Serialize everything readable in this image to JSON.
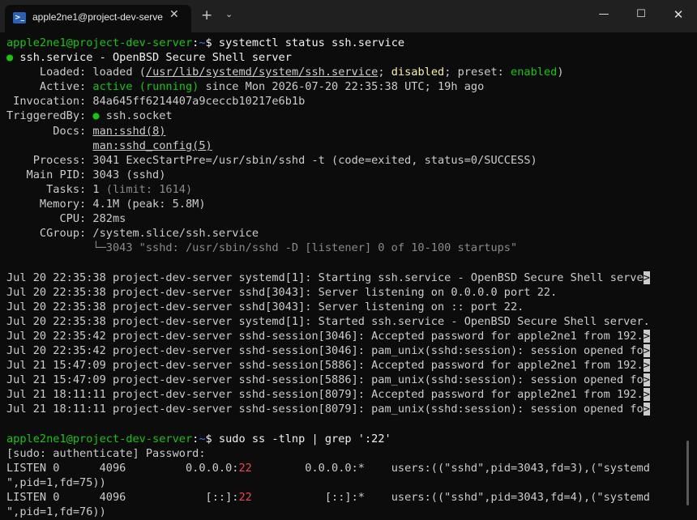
{
  "window": {
    "tab_title": "apple2ne1@project-dev-serve",
    "tab_icon": ">_",
    "close_glyph": "✕",
    "newtab_glyph": "+",
    "dropdown_glyph": "⌄",
    "min_glyph": "—",
    "max_glyph": "☐",
    "winclose_glyph": "✕"
  },
  "colors": {
    "background": "#0c0c0c",
    "prompt_user": "#16c60c",
    "prompt_path": "#3b78ff",
    "text": "#cccccc"
  },
  "prompt": {
    "user_host": "apple2ne1@project-dev-server",
    "sep": ":",
    "path": "~",
    "dollar": "$ "
  },
  "cmd1": "systemctl status ssh.service",
  "status": {
    "bullet": "●",
    "header": " ssh.service - OpenBSD Secure Shell server",
    "loaded_label": "     Loaded: ",
    "loaded_pre": "loaded (",
    "loaded_path": "/usr/lib/systemd/system/ssh.service",
    "loaded_sep1": "; ",
    "loaded_disabled": "disabled",
    "loaded_mid": "; preset: ",
    "loaded_enabled": "enabled",
    "loaded_end": ")",
    "active_label": "     Active: ",
    "active_state": "active (running)",
    "active_rest": " since Mon 2026-07-20 22:35:38 UTC; 19h ago",
    "invocation": " Invocation: 84a645ff6214407a9ceccb10217e6b1b",
    "triggered_label": "TriggeredBy: ",
    "triggered_rest": " ssh.socket",
    "docs_label": "       Docs: ",
    "docs1": "man:sshd(8)",
    "docs_indent": "             ",
    "docs2": "man:sshd_config(5)",
    "process": "    Process: 3041 ExecStartPre=/usr/sbin/sshd -t (code=exited, status=0/SUCCESS)",
    "mainpid": "   Main PID: 3043 (sshd)",
    "tasks_pre": "      Tasks: 1",
    "tasks_limit": " (limit: 1614)",
    "memory": "     Memory: 4.1M (peak: 5.8M)",
    "cpu": "        CPU: 282ms",
    "cgroup": "     CGroup: /system.slice/ssh.service",
    "cgroup_child": "             └─3043 \"sshd: /usr/sbin/sshd -D [listener] 0 of 10-100 startups\""
  },
  "logs": [
    {
      "text": "Jul 20 22:35:38 project-dev-server systemd[1]: Starting ssh.service - OpenBSD Secure Shell serve",
      "trunc": ">"
    },
    {
      "text": "Jul 20 22:35:38 project-dev-server sshd[3043]: Server listening on 0.0.0.0 port 22.",
      "trunc": ""
    },
    {
      "text": "Jul 20 22:35:38 project-dev-server sshd[3043]: Server listening on :: port 22.",
      "trunc": ""
    },
    {
      "text": "Jul 20 22:35:38 project-dev-server systemd[1]: Started ssh.service - OpenBSD Secure Shell server.",
      "trunc": ""
    },
    {
      "text": "Jul 20 22:35:42 project-dev-server sshd-session[3046]: Accepted password for apple2ne1 from 192.",
      "trunc": ">"
    },
    {
      "text": "Jul 20 22:35:42 project-dev-server sshd-session[3046]: pam_unix(sshd:session): session opened fo",
      "trunc": ">"
    },
    {
      "text": "Jul 21 15:47:09 project-dev-server sshd-session[5886]: Accepted password for apple2ne1 from 192.",
      "trunc": ">"
    },
    {
      "text": "Jul 21 15:47:09 project-dev-server sshd-session[5886]: pam_unix(sshd:session): session opened fo",
      "trunc": ">"
    },
    {
      "text": "Jul 21 18:11:11 project-dev-server sshd-session[8079]: Accepted password for apple2ne1 from 192.",
      "trunc": ">"
    },
    {
      "text": "Jul 21 18:11:11 project-dev-server sshd-session[8079]: pam_unix(sshd:session): session opened fo",
      "trunc": ">"
    }
  ],
  "cmd2": "sudo ss -tlnp | grep ':22'",
  "sudo_prompt": "[sudo: authenticate] Password:",
  "ss1": {
    "pre": "LISTEN 0      4096         0.0.0.0:",
    "port": "22",
    "post": "        0.0.0.0:*    users:((\"sshd\",pid=3043,fd=3),(\"systemd"
  },
  "ss1_cont": "\",pid=1,fd=75))",
  "ss2": {
    "pre": "LISTEN 0      4096            [::]:",
    "port": "22",
    "post": "           [::]:*    users:((\"sshd\",pid=3043,fd=4),(\"systemd"
  },
  "ss2_cont": "\",pid=1,fd=76))"
}
